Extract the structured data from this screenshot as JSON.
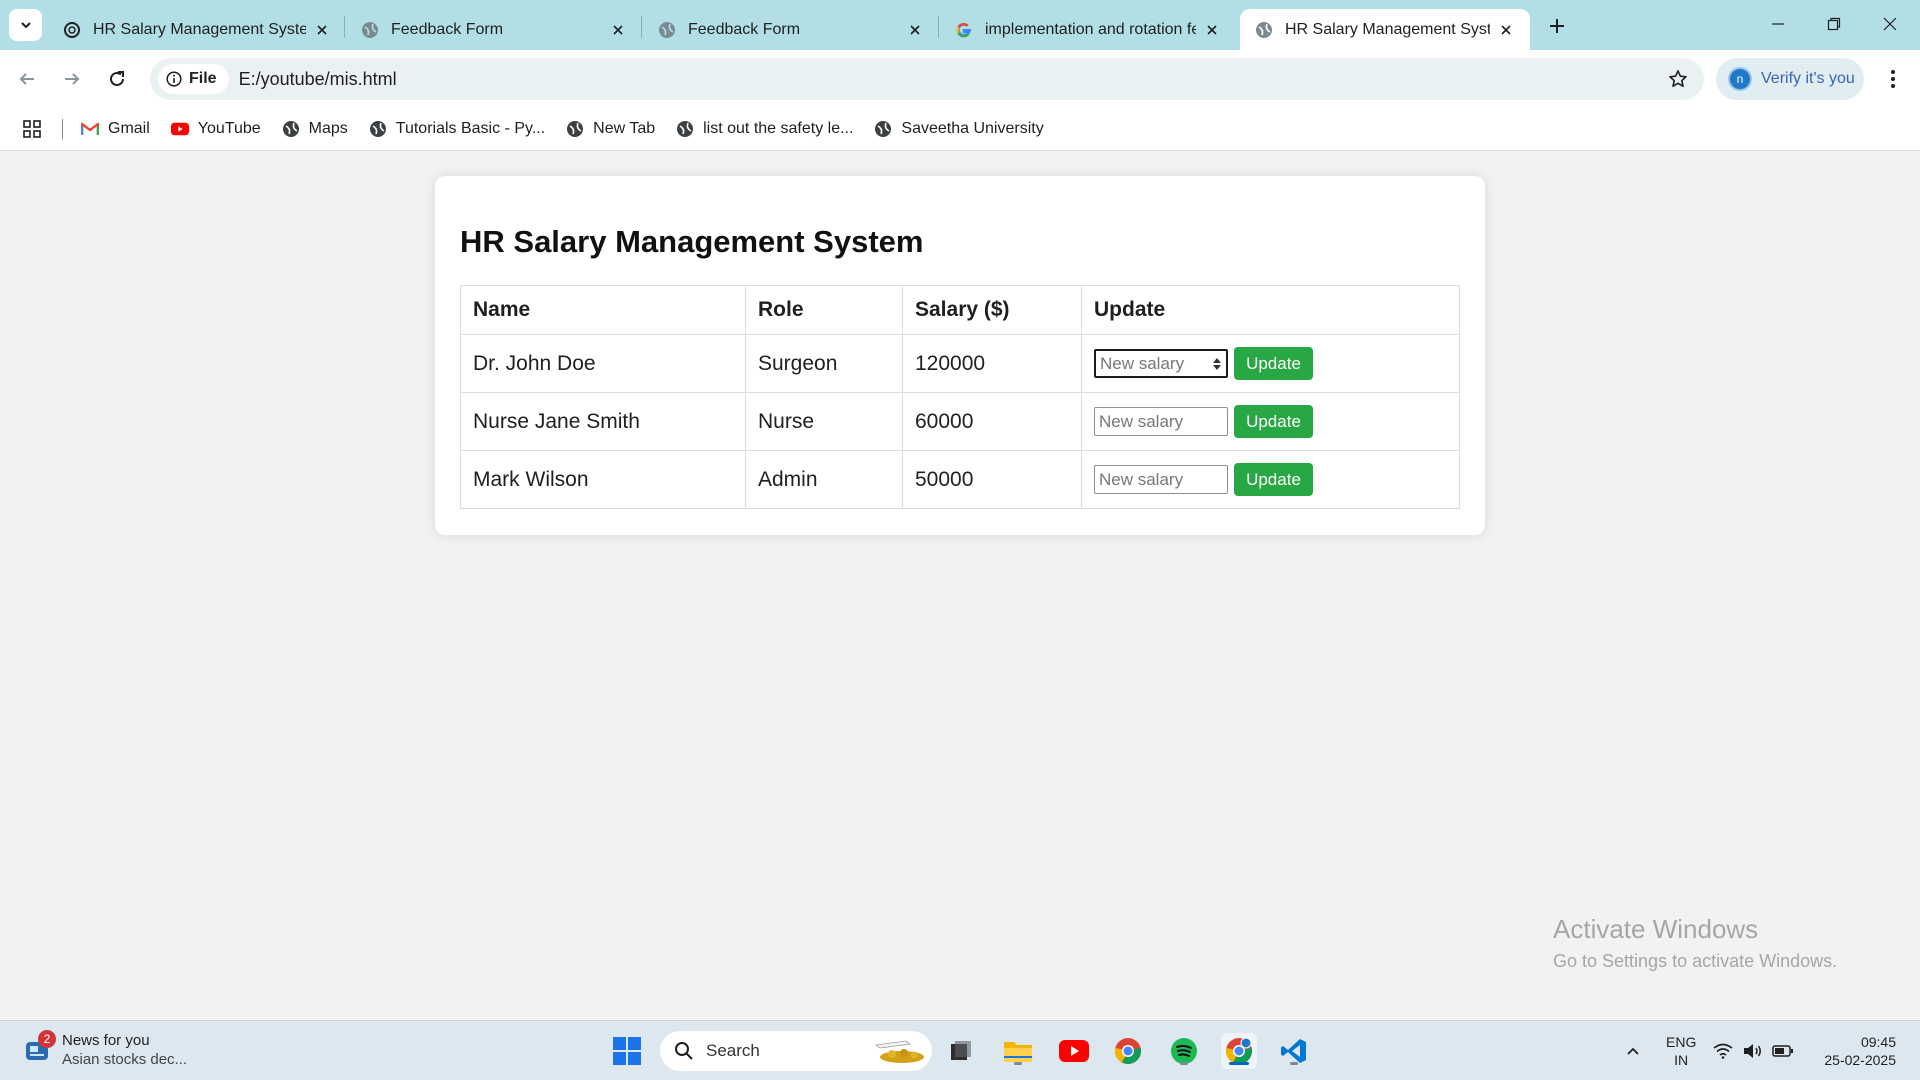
{
  "browser": {
    "tabs": [
      {
        "title": "HR Salary Management System",
        "active": false
      },
      {
        "title": "Feedback Form",
        "active": false
      },
      {
        "title": "Feedback Form",
        "active": false
      },
      {
        "title": "implementation and rotation fe",
        "active": false
      },
      {
        "title": "HR Salary Management System",
        "active": true
      }
    ],
    "site_chip": "File",
    "url": "E:/youtube/mis.html",
    "profile_label": "Verify it's you",
    "profile_initial": "n",
    "bookmarks": [
      "Gmail",
      "YouTube",
      "Maps",
      "Tutorials Basic - Py...",
      "New Tab",
      "list out the safety le...",
      "Saveetha University"
    ]
  },
  "page": {
    "title": "HR Salary Management System",
    "columns": [
      "Name",
      "Role",
      "Salary ($)",
      "Update"
    ],
    "rows": [
      {
        "name": "Dr. John Doe",
        "role": "Surgeon",
        "salary": "120000"
      },
      {
        "name": "Nurse Jane Smith",
        "role": "Nurse",
        "salary": "60000"
      },
      {
        "name": "Mark Wilson",
        "role": "Admin",
        "salary": "50000"
      }
    ],
    "input_placeholder": "New salary",
    "update_label": "Update"
  },
  "watermark": {
    "title": "Activate Windows",
    "subtitle": "Go to Settings to activate Windows."
  },
  "taskbar": {
    "news_badge": "2",
    "news_title": "News for you",
    "news_sub": "Asian stocks dec...",
    "search_label": "Search",
    "lang_top": "ENG",
    "lang_bottom": "IN",
    "time": "09:45",
    "date": "25-02-2025"
  },
  "colors": {
    "tabbar": "#b2dfe6",
    "update_button": "#28a745",
    "page_background": "#f2f2f2"
  }
}
